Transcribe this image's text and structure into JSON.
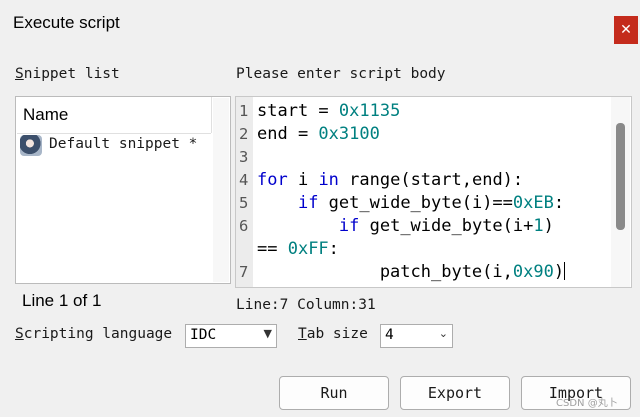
{
  "window": {
    "title": "Execute script",
    "close_glyph": "✕"
  },
  "snippets": {
    "label": "Snippet list",
    "header": "Name",
    "items": [
      {
        "name": "Default snippet *",
        "icon": "avatar-icon"
      }
    ],
    "status": "Line 1 of 1"
  },
  "editor": {
    "label": "Please enter script body",
    "line_numbers": [
      "1",
      "2",
      "3",
      "4",
      "5",
      "6",
      "7"
    ],
    "status": {
      "line_label": "Line:7",
      "column_label": "Column:31"
    }
  },
  "options": {
    "language_label": "Scripting language",
    "language_value": "IDC",
    "tab_label": "Tab size",
    "tab_value": "4"
  },
  "buttons": {
    "run": "Run",
    "export": "Export",
    "import": "Import"
  },
  "watermark": "CSDN @丸卜"
}
